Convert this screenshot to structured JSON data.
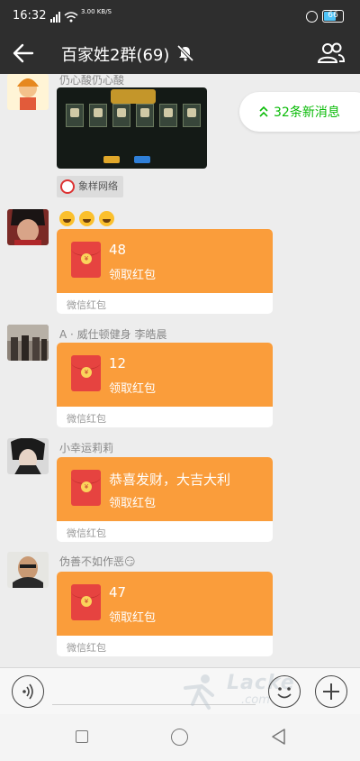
{
  "status_bar": {
    "time": "16:32",
    "network_speed": "3.00 KB/S",
    "battery": "66",
    "battery_level": 0.66
  },
  "nav": {
    "title": "百家姓2群(69)"
  },
  "new_messages": {
    "label": "32条新消息"
  },
  "messages": [
    {
      "sender": "仍心酸仍心酸",
      "type": "image",
      "tag_label": "象样网络"
    },
    {
      "sender": "",
      "type": "red_packet",
      "prefix": "😄😄😄",
      "amount": "48",
      "action": "领取红包",
      "brand": "微信红包"
    },
    {
      "sender": "A · 威仕顿健身 李皓晨",
      "type": "red_packet",
      "amount": "12",
      "action": "领取红包",
      "brand": "微信红包"
    },
    {
      "sender": "小幸运莉莉",
      "type": "red_packet",
      "amount": "恭喜发财，大吉大利",
      "action": "领取红包",
      "brand": "微信红包"
    },
    {
      "sender": "伪善不如作恶😏",
      "type": "red_packet",
      "amount": "47",
      "action": "领取红包",
      "brand": "微信红包"
    }
  ],
  "watermark": {
    "text": "Lacke",
    "sub": ".com"
  },
  "colors": {
    "header_bg": "#2e2e2e",
    "chat_bg": "#ededed",
    "red_packet": "#fa9d3b",
    "envelope": "#e64340",
    "accent_green": "#09bb07"
  },
  "icons": {
    "back": "arrow-left-icon",
    "mute": "bell-off-icon",
    "members": "group-icon",
    "voice": "voice-icon",
    "emoji": "smiley-icon",
    "more": "plus-icon"
  }
}
